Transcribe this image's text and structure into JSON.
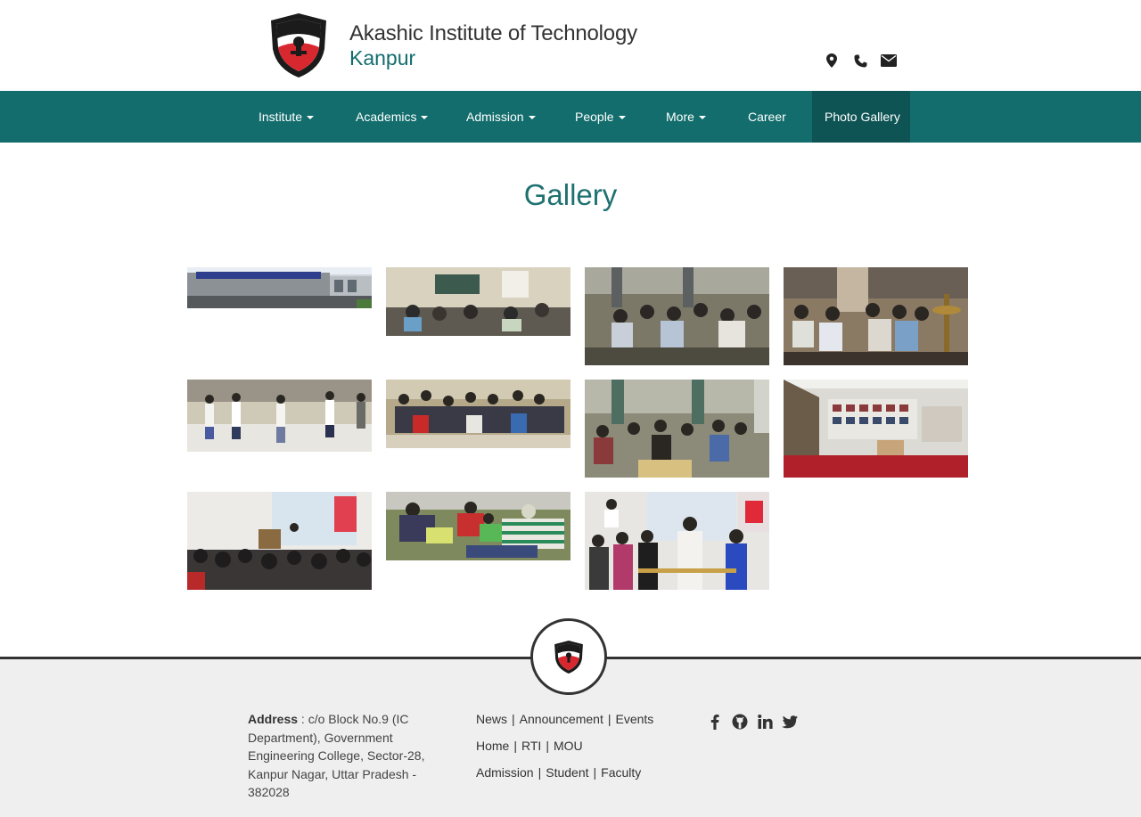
{
  "header": {
    "institute_name": "Akashic Institute of Technology",
    "city": "Kanpur",
    "contact_icons": [
      "map-marker-icon",
      "phone-icon",
      "envelope-icon"
    ]
  },
  "nav": {
    "items": [
      {
        "label": "Institute",
        "dropdown": true
      },
      {
        "label": "Academics",
        "dropdown": true
      },
      {
        "label": "Admission",
        "dropdown": true
      },
      {
        "label": "People",
        "dropdown": true
      },
      {
        "label": "More",
        "dropdown": true
      },
      {
        "label": "Career",
        "dropdown": false
      },
      {
        "label": "Photo Gallery",
        "dropdown": false,
        "active": true
      }
    ]
  },
  "gallery": {
    "title": "Gallery",
    "photos": [
      "institute-building-photo",
      "classroom-photo",
      "seminar-audience-photo",
      "lamp-lighting-photo",
      "dance-event-photo",
      "group-students-photo",
      "hall-audience-photo",
      "exhibition-room-photo",
      "annual-day-audience-photo",
      "outdoor-activity-photo",
      "award-ceremony-photo"
    ]
  },
  "footer": {
    "address_label": "Address",
    "address_text": ": c/o Block No.9 (IC Department), Government Engineering College, Sector-28, Kanpur Nagar, Uttar Pradesh - 382028",
    "link_rows": [
      [
        "News",
        "Announcement",
        "Events"
      ],
      [
        "Home",
        "RTI",
        "MOU"
      ],
      [
        "Admission",
        "Student",
        "Faculty"
      ]
    ],
    "social_icons": [
      "facebook-icon",
      "github-icon",
      "linkedin-icon",
      "twitter-icon"
    ]
  },
  "colors": {
    "primary": "#136d6d",
    "primary_dark": "#0e5454",
    "logo_red": "#d8282f",
    "footer_bg": "#efefef"
  }
}
